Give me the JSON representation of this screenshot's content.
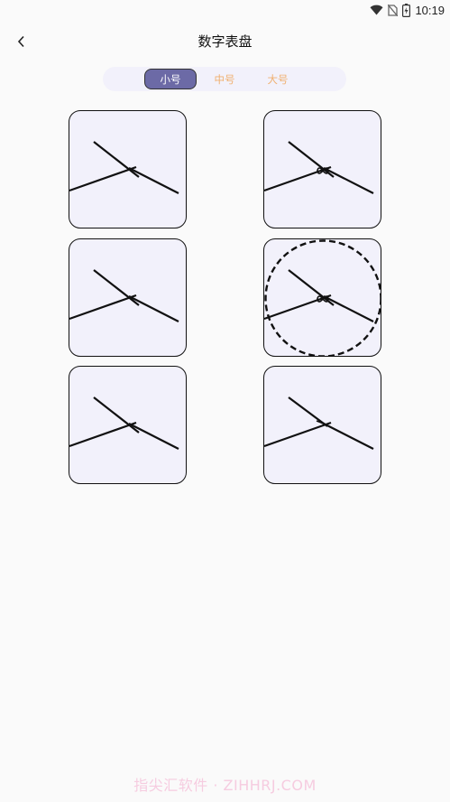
{
  "status_bar": {
    "time": "10:19",
    "icons": [
      "wifi-icon",
      "no-sim-icon",
      "battery-icon"
    ]
  },
  "header": {
    "title": "数字表盘",
    "back_icon": "chevron-left-icon"
  },
  "size_tabs": [
    {
      "label": "小号",
      "selected": true
    },
    {
      "label": "中号",
      "selected": false
    },
    {
      "label": "大号",
      "selected": false
    }
  ],
  "colors": {
    "accent": "#6c6aa6",
    "tab_inactive": "#f0b070",
    "card_bg": "#f2f1fb",
    "page_bg": "#fafafa"
  },
  "watch_faces": [
    {
      "style": "plain"
    },
    {
      "style": "bow-center"
    },
    {
      "style": "plain"
    },
    {
      "style": "dashed-circle"
    },
    {
      "style": "plain"
    },
    {
      "style": "plain"
    }
  ],
  "watermark": "指尖汇软件 · ZIHHRJ.COM"
}
